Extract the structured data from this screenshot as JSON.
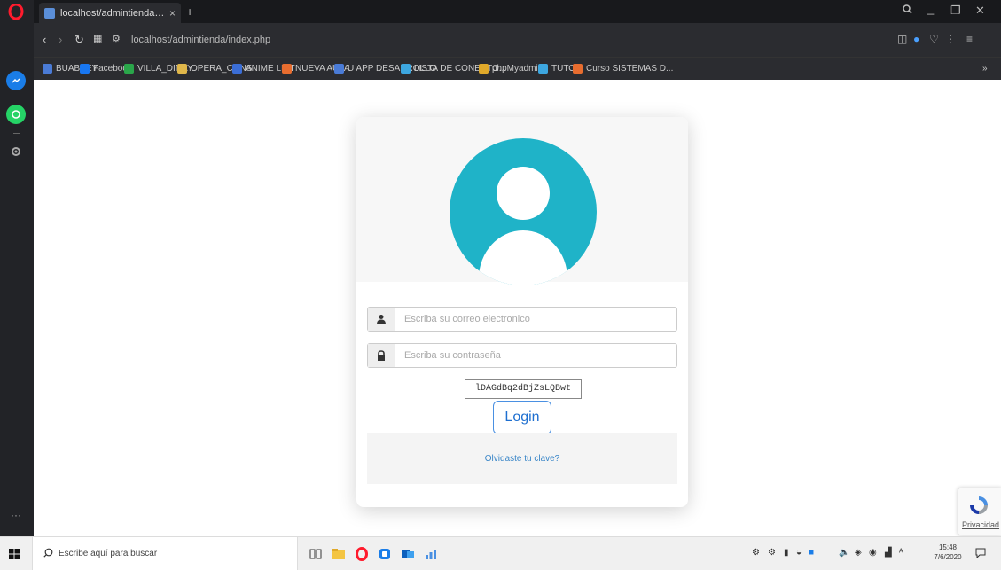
{
  "browser": {
    "tab_title": "localhost/admintienda/php",
    "tab_close": "×",
    "new_tab": "+",
    "url": "localhost/admintienda/index.php",
    "bookmarks": [
      {
        "label": "BUABSEY",
        "color": "#4a7bd6"
      },
      {
        "label": "Facebook",
        "color": "#1877f2"
      },
      {
        "label": "VILLA_DINAY",
        "color": "#2aa64a"
      },
      {
        "label": "OPERA_CONS",
        "color": "#e0b74a"
      },
      {
        "label": "ANIME LIST",
        "color": "#3b6ed6"
      },
      {
        "label": "NUEVA AULA",
        "color": "#e86d2f"
      },
      {
        "label": "U APP DESARROLLO",
        "color": "#4a7bd6"
      },
      {
        "label": "LISTA DE CONECTO...",
        "color": "#3da7e0"
      },
      {
        "label": "phpMyadmin",
        "color": "#e0a92a"
      },
      {
        "label": "TUTO",
        "color": "#3da7e0"
      },
      {
        "label": "Curso SISTEMAS D...",
        "color": "#e86d2f"
      }
    ]
  },
  "login": {
    "email_placeholder": "Escriba su correo electronico",
    "password_placeholder": "Escriba su contraseña",
    "captcha_code": "lDAGdBq2dBjZsLQBwt",
    "login_label": "Login",
    "forgot_label": "Olvidaste tu clave?",
    "avatar_color": "#1fb3c8"
  },
  "recaptcha": {
    "label": "Privacidad"
  },
  "taskbar": {
    "search_placeholder": "Escribe aquí para buscar",
    "time": "15:48",
    "date": "7/6/2020"
  }
}
